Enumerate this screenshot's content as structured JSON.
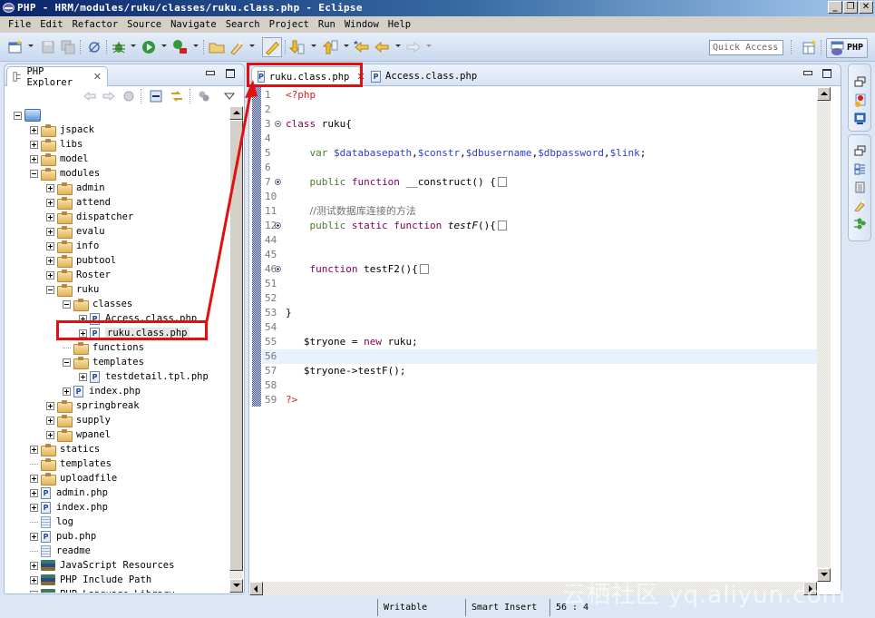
{
  "window": {
    "title": "PHP - HRM/modules/ruku/classes/ruku.class.php - Eclipse",
    "controls": {
      "minimize": "_",
      "restore": "❐",
      "close": "✕"
    }
  },
  "menubar": [
    "File",
    "Edit",
    "Refactor",
    "Source",
    "Navigate",
    "Search",
    "Project",
    "Run",
    "Window",
    "Help"
  ],
  "toolbar": {
    "icons": [
      "new-icon",
      "save-icon",
      "save-all-icon",
      "toggle-breakpoint-icon",
      "debug-icon",
      "run-icon",
      "run-external-icon",
      "open-type-icon",
      "search-icon",
      "toggle-mark-occurrences-icon",
      "next-annotation-icon",
      "previous-annotation-icon",
      "last-edit-location-icon",
      "back-icon",
      "forward-icon"
    ],
    "quick_access_placeholder": "Quick Access",
    "open_perspective_icon": "open-perspective-icon",
    "perspective_label": "PHP"
  },
  "explorer": {
    "title": "PHP Explorer",
    "close": "✕",
    "toolbar_icons": [
      "back-icon",
      "forward-icon",
      "up-icon",
      "collapse-all-icon",
      "link-with-editor-icon",
      "filters-icon",
      "view-menu-icon"
    ],
    "tree": [
      {
        "label": "",
        "type": "project",
        "depth": 0,
        "state": "expanded"
      },
      {
        "label": "jspack",
        "type": "folder",
        "depth": 1,
        "state": "collapsed"
      },
      {
        "label": "libs",
        "type": "folder",
        "depth": 1,
        "state": "collapsed"
      },
      {
        "label": "model",
        "type": "folder",
        "depth": 1,
        "state": "collapsed"
      },
      {
        "label": "modules",
        "type": "folder",
        "depth": 1,
        "state": "expanded"
      },
      {
        "label": "admin",
        "type": "folder",
        "depth": 2,
        "state": "collapsed"
      },
      {
        "label": "attend",
        "type": "folder",
        "depth": 2,
        "state": "collapsed"
      },
      {
        "label": "dispatcher",
        "type": "folder",
        "depth": 2,
        "state": "collapsed"
      },
      {
        "label": "evalu",
        "type": "folder",
        "depth": 2,
        "state": "collapsed"
      },
      {
        "label": "info",
        "type": "folder",
        "depth": 2,
        "state": "collapsed"
      },
      {
        "label": "pubtool",
        "type": "folder",
        "depth": 2,
        "state": "collapsed"
      },
      {
        "label": "Roster",
        "type": "folder",
        "depth": 2,
        "state": "collapsed"
      },
      {
        "label": "ruku",
        "type": "folder",
        "depth": 2,
        "state": "expanded"
      },
      {
        "label": "classes",
        "type": "folder",
        "depth": 3,
        "state": "expanded"
      },
      {
        "label": "Access.class.php",
        "type": "php",
        "depth": 4,
        "state": "collapsed"
      },
      {
        "label": "ruku.class.php",
        "type": "php",
        "depth": 4,
        "state": "collapsed",
        "selected": true
      },
      {
        "label": "functions",
        "type": "folder",
        "depth": 3,
        "state": "leaf"
      },
      {
        "label": "templates",
        "type": "folder",
        "depth": 3,
        "state": "expanded"
      },
      {
        "label": "testdetail.tpl.php",
        "type": "php",
        "depth": 4,
        "state": "collapsed"
      },
      {
        "label": "index.php",
        "type": "php",
        "depth": 3,
        "state": "collapsed"
      },
      {
        "label": "springbreak",
        "type": "folder",
        "depth": 2,
        "state": "collapsed"
      },
      {
        "label": "supply",
        "type": "folder",
        "depth": 2,
        "state": "collapsed"
      },
      {
        "label": "wpanel",
        "type": "folder",
        "depth": 2,
        "state": "collapsed"
      },
      {
        "label": "statics",
        "type": "folder",
        "depth": 1,
        "state": "collapsed"
      },
      {
        "label": "templates",
        "type": "folder",
        "depth": 1,
        "state": "leaf"
      },
      {
        "label": "uploadfile",
        "type": "folder",
        "depth": 1,
        "state": "collapsed"
      },
      {
        "label": "admin.php",
        "type": "php",
        "depth": 1,
        "state": "collapsed"
      },
      {
        "label": "index.php",
        "type": "php",
        "depth": 1,
        "state": "collapsed"
      },
      {
        "label": "log",
        "type": "text",
        "depth": 1,
        "state": "leaf"
      },
      {
        "label": "pub.php",
        "type": "php",
        "depth": 1,
        "state": "collapsed"
      },
      {
        "label": "readme",
        "type": "text",
        "depth": 1,
        "state": "leaf"
      },
      {
        "label": "JavaScript Resources",
        "type": "library",
        "depth": 1,
        "state": "collapsed"
      },
      {
        "label": "PHP Include Path",
        "type": "library",
        "depth": 1,
        "state": "collapsed"
      },
      {
        "label": "PHP Language Library",
        "type": "library",
        "depth": 1,
        "state": "collapsed"
      }
    ]
  },
  "editor": {
    "tabs": [
      {
        "label": "ruku.class.php",
        "active": true,
        "close": "✕"
      },
      {
        "label": "Access.class.php",
        "active": false
      }
    ],
    "file_icon_letter": "P",
    "lines": [
      {
        "n": "1",
        "parts": [
          [
            "t",
            "<?php"
          ]
        ]
      },
      {
        "n": "2",
        "parts": []
      },
      {
        "n": "3",
        "fold": "minus",
        "parts": [
          [
            "k",
            "class"
          ],
          [
            "",
            " ruku{"
          ]
        ]
      },
      {
        "n": "4",
        "parts": []
      },
      {
        "n": "5",
        "parts": [
          [
            "",
            "    "
          ],
          [
            "kg",
            "var"
          ],
          [
            "",
            " "
          ],
          [
            "v",
            "$databasepath"
          ],
          [
            "",
            ","
          ],
          [
            "v",
            "$constr"
          ],
          [
            "",
            ","
          ],
          [
            "v",
            "$dbusername"
          ],
          [
            "",
            ","
          ],
          [
            "v",
            "$dbpassword"
          ],
          [
            "",
            ","
          ],
          [
            "v",
            "$link"
          ],
          [
            "",
            ";"
          ]
        ]
      },
      {
        "n": "6",
        "parts": []
      },
      {
        "n": "7",
        "fold": "plus",
        "parts": [
          [
            "",
            "    "
          ],
          [
            "kg",
            "public"
          ],
          [
            "",
            " "
          ],
          [
            "k",
            "function"
          ],
          [
            "",
            " __construct() {"
          ]
        ],
        "collapsed": true
      },
      {
        "n": "10",
        "parts": []
      },
      {
        "n": "11",
        "parts": [
          [
            "",
            "    "
          ],
          [
            "cm",
            "//测试数据库连接的方法"
          ]
        ]
      },
      {
        "n": "12",
        "fold": "plus",
        "parts": [
          [
            "",
            "    "
          ],
          [
            "kg",
            "public"
          ],
          [
            "",
            " "
          ],
          [
            "k",
            "static"
          ],
          [
            "",
            " "
          ],
          [
            "k",
            "function"
          ],
          [
            "",
            " "
          ],
          [
            "it",
            "testF"
          ],
          [
            "",
            "(){"
          ]
        ],
        "collapsed": true
      },
      {
        "n": "44",
        "parts": []
      },
      {
        "n": "45",
        "parts": []
      },
      {
        "n": "46",
        "fold": "plus",
        "parts": [
          [
            "",
            "    "
          ],
          [
            "k",
            "function"
          ],
          [
            "",
            " testF2(){"
          ]
        ],
        "collapsed": true
      },
      {
        "n": "51",
        "parts": []
      },
      {
        "n": "52",
        "parts": []
      },
      {
        "n": "53",
        "parts": [
          [
            "",
            "}"
          ]
        ]
      },
      {
        "n": "54",
        "parts": []
      },
      {
        "n": "55",
        "parts": [
          [
            "",
            "   $tryone = "
          ],
          [
            "k",
            "new"
          ],
          [
            "",
            " ruku;"
          ]
        ]
      },
      {
        "n": "56",
        "parts": [],
        "current": true
      },
      {
        "n": "57",
        "parts": [
          [
            "",
            "   $tryone->testF();"
          ]
        ]
      },
      {
        "n": "58",
        "parts": []
      },
      {
        "n": "59",
        "parts": [
          [
            "t",
            "?>"
          ]
        ]
      }
    ]
  },
  "right_trim": {
    "group1": [
      "restore-icon",
      "problems-icon",
      "console-icon"
    ],
    "group2": [
      "restore-icon",
      "outline-icon",
      "tasks-icon",
      "search-results-icon",
      "debug-variables-icon"
    ]
  },
  "statusbar": {
    "writable": "Writable",
    "insert_mode": "Smart Insert",
    "position": "56 : 4"
  },
  "watermark": "云栖社区 yq.aliyun.com"
}
